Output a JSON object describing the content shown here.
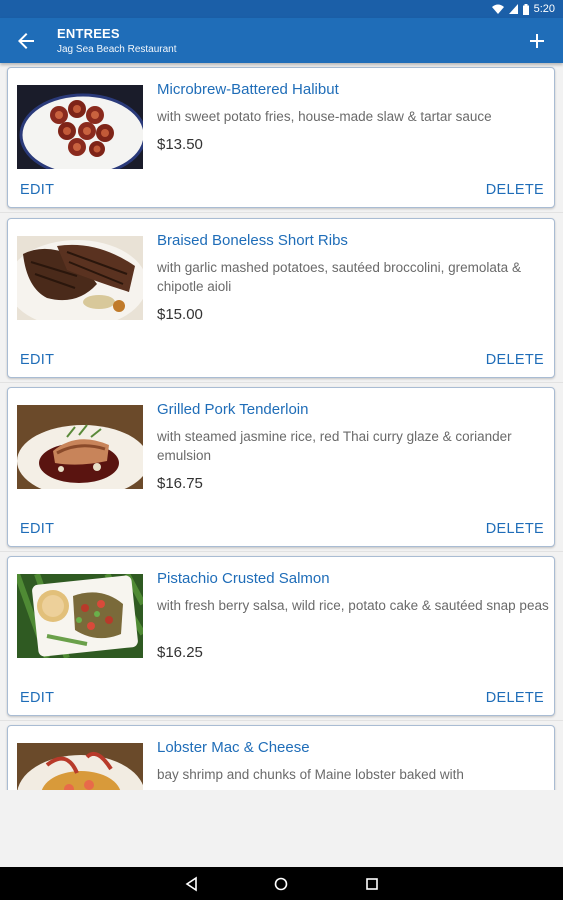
{
  "status_bar": {
    "time": "5:20"
  },
  "app_bar": {
    "title": "ENTREES",
    "subtitle": "Jag Sea Beach Restaurant"
  },
  "items": [
    {
      "name": "Microbrew-Battered Halibut",
      "description": "with sweet potato fries, house-made slaw & tartar sauce",
      "price": "$13.50",
      "edit_label": "EDIT",
      "delete_label": "DELETE"
    },
    {
      "name": "Braised Boneless Short Ribs",
      "description": "with garlic mashed potatoes, sautéed broccolini, gremolata & chipotle aioli",
      "price": "$15.00",
      "edit_label": "EDIT",
      "delete_label": "DELETE"
    },
    {
      "name": "Grilled Pork Tenderloin",
      "description": "with steamed jasmine rice, red Thai curry glaze & coriander emulsion",
      "price": "$16.75",
      "edit_label": "EDIT",
      "delete_label": "DELETE"
    },
    {
      "name": "Pistachio Crusted Salmon",
      "description": "with fresh berry salsa, wild rice, potato cake & sautéed snap peas",
      "price": "$16.25",
      "edit_label": "EDIT",
      "delete_label": "DELETE"
    },
    {
      "name": "Lobster Mac & Cheese",
      "description": "bay shrimp and chunks of Maine lobster baked with",
      "price": "",
      "edit_label": "",
      "delete_label": ""
    }
  ],
  "colors": {
    "accent": "#1f6db8",
    "status_bar": "#1b5fa8",
    "background": "#f2f2f2"
  }
}
